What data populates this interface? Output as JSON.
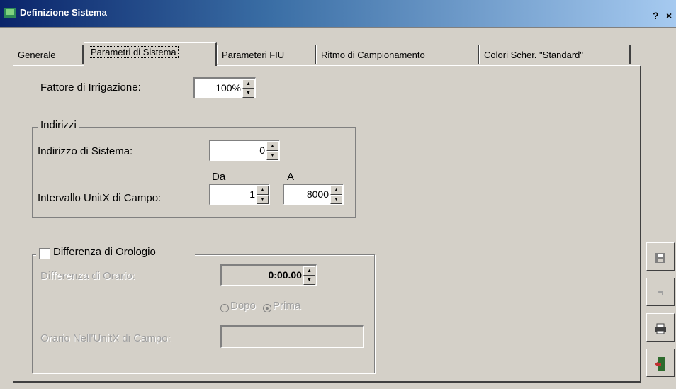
{
  "window": {
    "title": "Definizione Sistema",
    "help_label": "?",
    "close_label": "×"
  },
  "tabs": [
    {
      "label": "Generale",
      "active": false
    },
    {
      "label": "Parametri di Sistema",
      "active": true
    },
    {
      "label": "Parameteri FIU",
      "active": false
    },
    {
      "label": "Ritmo di Campionamento",
      "active": false
    },
    {
      "label": "Colori Scher. \"Standard\"",
      "active": false
    }
  ],
  "irrigation": {
    "label": "Fattore di Irrigazione:",
    "value": "100%"
  },
  "addresses": {
    "group_label": "Indirizzi",
    "system_address_label": "Indirizzo di Sistema:",
    "system_address_value": "0",
    "range_label": "Intervallo UnitX di Campo:",
    "from_label": "Da",
    "to_label": "A",
    "from_value": "1",
    "to_value": "8000"
  },
  "clock": {
    "checkbox_label": "Differenza di Orologio",
    "checked": false,
    "time_diff_label": "Differenza di Orario:",
    "time_diff_value": "0:00.00",
    "radio_after_label": "Dopo",
    "radio_before_label": "Prima",
    "selected_radio": "Prima",
    "field_time_label": "Orario Nell'UnitX di Campo:",
    "field_time_value": ""
  },
  "side_buttons": [
    {
      "icon": "floppy-disk-icon"
    },
    {
      "icon": "undo-icon"
    },
    {
      "icon": "printer-icon"
    },
    {
      "icon": "exit-door-icon"
    }
  ]
}
